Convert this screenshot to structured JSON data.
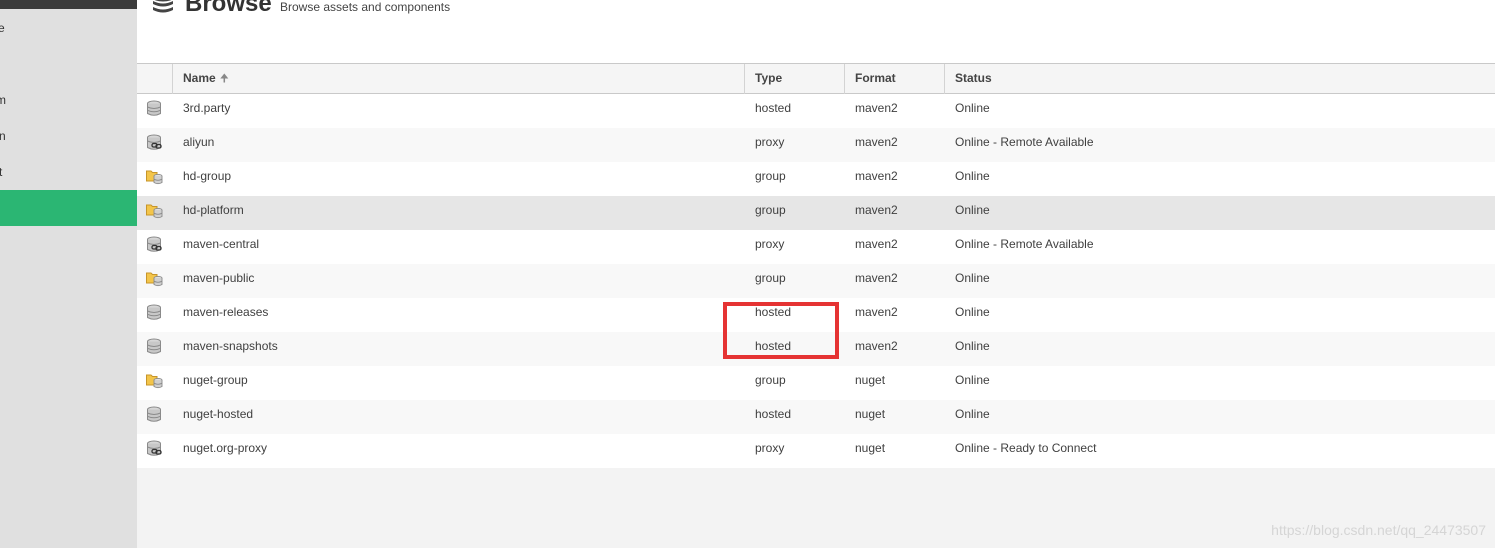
{
  "header": {
    "title": "Browse",
    "subtitle": "Browse assets and components",
    "icon": "database-icon"
  },
  "sidebar": {
    "items": [
      {
        "label": "e",
        "active": false
      },
      {
        "label": "m",
        "active": false
      },
      {
        "label": "n",
        "active": false
      },
      {
        "label": "t",
        "active": false
      },
      {
        "label": "",
        "active": true
      }
    ],
    "active_color": "#2bb673"
  },
  "table": {
    "columns": {
      "name": "Name",
      "type": "Type",
      "format": "Format",
      "status": "Status"
    },
    "sort": {
      "column": "Name",
      "direction": "ascending"
    },
    "rows": [
      {
        "icon": "hosted-repo-icon",
        "name": "3rd.party",
        "type": "hosted",
        "format": "maven2",
        "status": "Online"
      },
      {
        "icon": "proxy-repo-icon",
        "name": "aliyun",
        "type": "proxy",
        "format": "maven2",
        "status": "Online - Remote Available"
      },
      {
        "icon": "group-repo-icon",
        "name": "hd-group",
        "type": "group",
        "format": "maven2",
        "status": "Online"
      },
      {
        "icon": "group-repo-icon",
        "name": "hd-platform",
        "type": "group",
        "format": "maven2",
        "status": "Online",
        "selected": true
      },
      {
        "icon": "proxy-repo-icon",
        "name": "maven-central",
        "type": "proxy",
        "format": "maven2",
        "status": "Online - Remote Available"
      },
      {
        "icon": "group-repo-icon",
        "name": "maven-public",
        "type": "group",
        "format": "maven2",
        "status": "Online"
      },
      {
        "icon": "hosted-repo-icon",
        "name": "maven-releases",
        "type": "hosted",
        "format": "maven2",
        "status": "Online"
      },
      {
        "icon": "hosted-repo-icon",
        "name": "maven-snapshots",
        "type": "hosted",
        "format": "maven2",
        "status": "Online"
      },
      {
        "icon": "group-repo-icon",
        "name": "nuget-group",
        "type": "group",
        "format": "nuget",
        "status": "Online"
      },
      {
        "icon": "hosted-repo-icon",
        "name": "nuget-hosted",
        "type": "hosted",
        "format": "nuget",
        "status": "Online"
      },
      {
        "icon": "proxy-repo-icon",
        "name": "nuget.org-proxy",
        "type": "proxy",
        "format": "nuget",
        "status": "Online - Ready to Connect"
      }
    ]
  },
  "annotation": {
    "color": "#e53333"
  },
  "watermark": "https://blog.csdn.net/qq_24473507"
}
